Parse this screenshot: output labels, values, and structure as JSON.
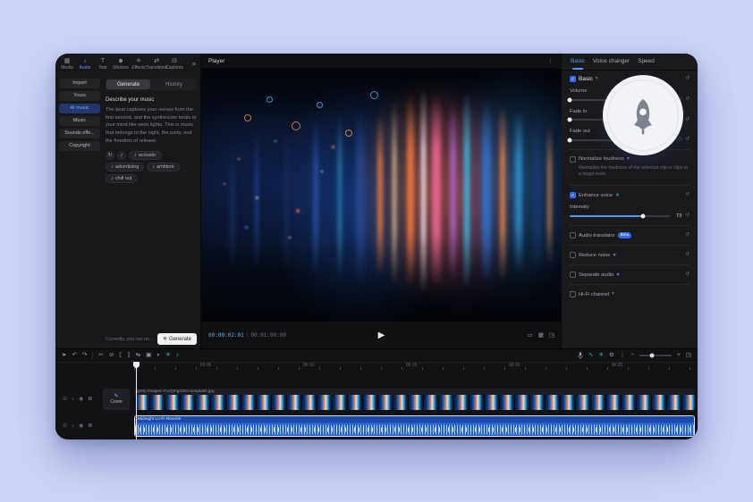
{
  "tab_bar": {
    "items": [
      {
        "label": "Media",
        "icon": "▦"
      },
      {
        "label": "Audio",
        "icon": "♪"
      },
      {
        "label": "Text",
        "icon": "T"
      },
      {
        "label": "Stickers",
        "icon": "☻"
      },
      {
        "label": "Effects",
        "icon": "✳"
      },
      {
        "label": "Transitions",
        "icon": "⇄"
      },
      {
        "label": "Captions",
        "icon": "⊟"
      }
    ],
    "menu_icon": "≡"
  },
  "library": {
    "nav": [
      "Import",
      "Yours",
      "AI music",
      "Music",
      "Sounds effe...",
      "Copyright"
    ],
    "tabs": [
      "Generate",
      "History"
    ],
    "describe_label": "Describe your music",
    "description": "The beat captures your nerves from the first second, and the synthesizer beats in your mind like neon lights. This is music that belongs to the night, the party, and the freedom of release.",
    "chip_icon_refresh": "↻",
    "chip_icon_note": "♪",
    "chips": [
      "acoustic",
      "advertising",
      "ambient",
      "chill out"
    ],
    "footer_note": "Currently, you can only gen...",
    "generate": {
      "icon": "✳",
      "label": "Generate"
    }
  },
  "player": {
    "title": "Player",
    "more_icon": "⋮",
    "current_time": "00:00:02:01",
    "separator": "|",
    "duration": "00:01:00:00",
    "play_icon": "▶",
    "ratio_icon": "▭",
    "grid_icon": "▦",
    "fullscreen_icon": "◳"
  },
  "properties": {
    "tabs": [
      "Basic",
      "Voice changer",
      "Speed"
    ],
    "check_icon": "✓",
    "caret_icon": "▾",
    "reset_icon": "↺",
    "keyframe_icon": "◇",
    "heart_icon": "♥",
    "spark_icon": "✳",
    "basic": {
      "label": "Basic"
    },
    "volume": {
      "label": "Volume",
      "percent": 0
    },
    "fade_in": {
      "label": "Fade in",
      "percent": 0
    },
    "fade_out": {
      "label": "Fade out",
      "percent": 0
    },
    "normalize": {
      "label": "Normalize loudness",
      "desc": "Normalize the loudness of the selected clip or clips to a target level."
    },
    "enhance": {
      "label": "Enhance voice"
    },
    "intensity": {
      "label": "Intensity",
      "value": "73",
      "percent": 73
    },
    "translator": {
      "label": "Audio translator",
      "badge": "Beta"
    },
    "reduce": {
      "label": "Reduce noise"
    },
    "separate": {
      "label": "Separate audio"
    },
    "channel": {
      "label": "Hi-Fi channel"
    }
  },
  "timeline": {
    "tools_left": [
      {
        "name": "select",
        "glyph": "➤"
      },
      {
        "name": "undo",
        "glyph": "↶"
      },
      {
        "name": "redo",
        "glyph": "↷"
      },
      {
        "name": "split",
        "glyph": "✂"
      },
      {
        "name": "delete",
        "glyph": "⊘"
      },
      {
        "name": "trim-left",
        "glyph": "⟦"
      },
      {
        "name": "trim-right",
        "glyph": "⟧"
      },
      {
        "name": "mirror",
        "glyph": "⇆"
      },
      {
        "name": "crop",
        "glyph": "▣"
      },
      {
        "name": "mask",
        "glyph": "◐"
      },
      {
        "name": "ai-effects",
        "glyph": "✳"
      },
      {
        "name": "beat-detect",
        "glyph": "♪"
      }
    ],
    "tools_right": [
      {
        "name": "ai-audio",
        "glyph": "∿"
      },
      {
        "name": "smart-edit",
        "glyph": "✳"
      },
      {
        "name": "settings",
        "glyph": "⚙"
      },
      {
        "name": "more",
        "glyph": "⋮"
      }
    ],
    "zoom_out_icon": "−",
    "zoom_in_icon": "+",
    "fit_icon": "◳",
    "zoom_percent": 40,
    "ruler": [
      "00:05",
      "00:10",
      "00:15",
      "00:20",
      "00:25"
    ],
    "track_icons": [
      "⊙",
      "♪",
      "◉",
      "⊠"
    ],
    "cover": {
      "icon": "✎",
      "label": "Cover"
    },
    "video_clip": "getty-images-YxvQmgrXEn-unsplash.jpg",
    "audio_clip": "Midnight Lo-Fi Reverie"
  },
  "colors": {
    "accent_blue": "#4e9bff",
    "accent_cyan": "#27d0c0",
    "clip_blue": "#2a63c8",
    "badge_blue": "#2f6bff",
    "heart_purple": "#8a63ff"
  }
}
